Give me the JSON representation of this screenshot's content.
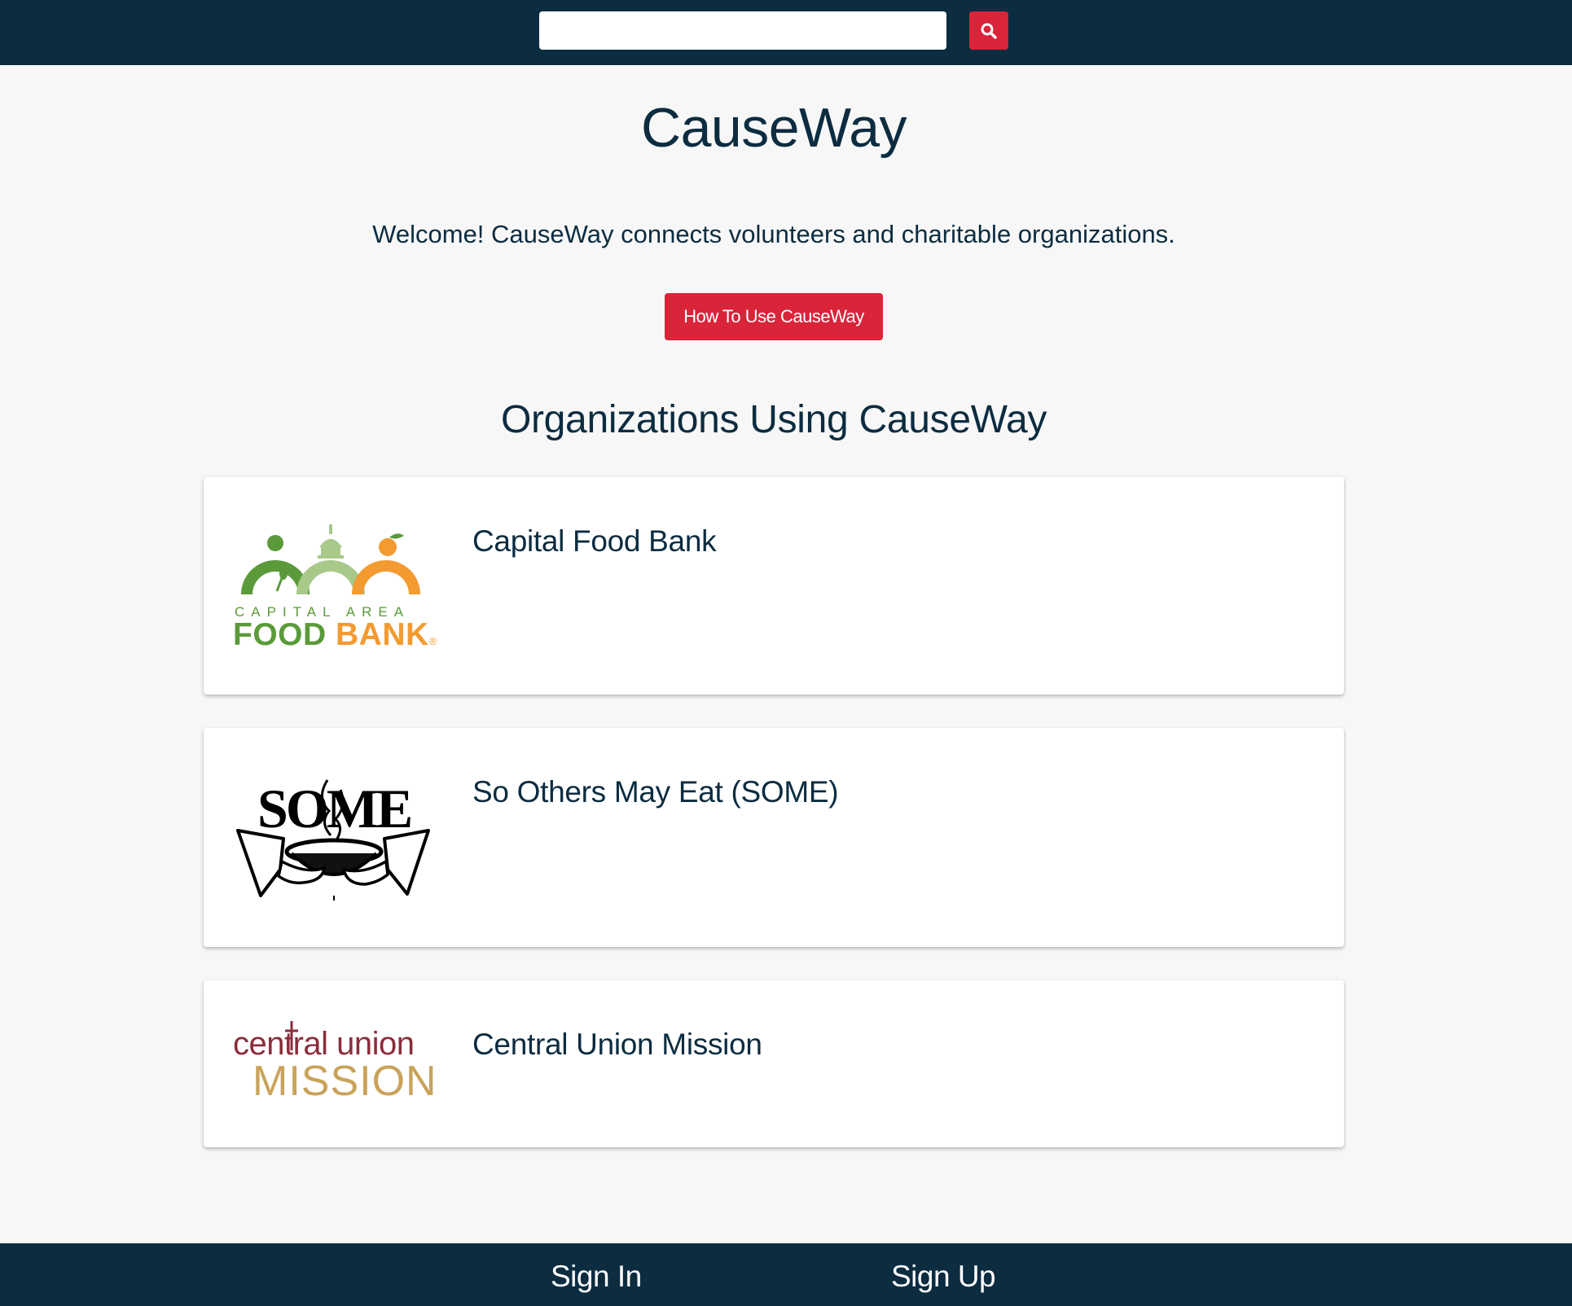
{
  "header": {
    "search": {
      "value": "",
      "placeholder": ""
    },
    "search_icon": "search-icon",
    "accent_color": "#d9243a",
    "bar_color": "#0c2c40"
  },
  "main": {
    "title": "CauseWay",
    "welcome": "Welcome! CauseWay connects volunteers and charitable organizations.",
    "how_to_button": "How To Use CauseWay",
    "orgs_heading": "Organizations Using CauseWay",
    "organizations": [
      {
        "name": "Capital Food Bank",
        "logo": {
          "line1": "CAPITAL AREA",
          "line2a": "FOOD",
          "line2b": "BANK",
          "mark": "®"
        }
      },
      {
        "name": "So Others May Eat (SOME)",
        "logo": {
          "text": "SOME"
        }
      },
      {
        "name": "Central Union Mission",
        "logo": {
          "line1": "central union",
          "line2": "MISSION"
        }
      }
    ]
  },
  "footer": {
    "sign_in": "Sign In",
    "sign_up": "Sign Up"
  }
}
